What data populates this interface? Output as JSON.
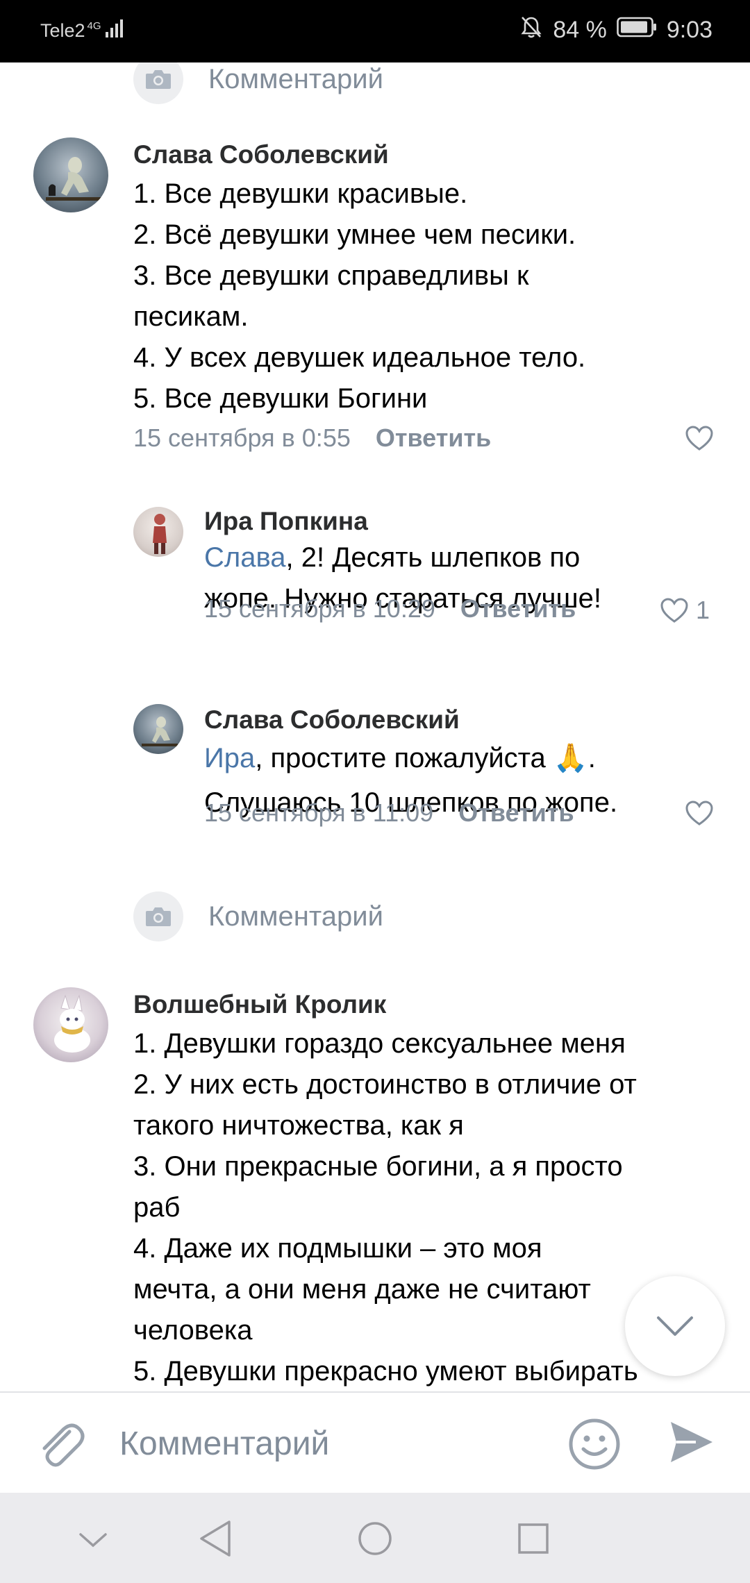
{
  "status_bar": {
    "carrier": "Tele2",
    "network": "4G",
    "battery": "84 %",
    "time": "9:03",
    "icons": [
      "signal-icon",
      "mute-bell-icon",
      "battery-icon"
    ]
  },
  "comments": [
    {
      "author": "Слава Соболевский",
      "lines": [
        "1. Все девушки красивые.",
        "2. Всё девушки умнее чем песики.",
        "3. Все девушки справедливы к",
        "песикам.",
        "4. У всех девушек идеальное тело.",
        "5. Все девушки Богини"
      ],
      "date": "15 сентября в 0:55",
      "reply_label": "Ответить",
      "likes": ""
    },
    {
      "author": "Ира Попкина",
      "mention": "Слава",
      "line1_rest": ", 2! Десять шлепков по",
      "line2": "жопе. Нужно стараться лучше!",
      "date": "15 сентября в 10:29",
      "reply_label": "Ответить",
      "likes": "1"
    },
    {
      "author": "Слава Соболевский",
      "mention": "Ира",
      "line1_rest": ", простите пожалуйста 🙏.",
      "line2": "Слушаюсь 10 шлепков по жопе.",
      "date": "15 сентября в 11:09",
      "reply_label": "Ответить",
      "likes": ""
    },
    {
      "author": "Волшебный Кролик",
      "lines": [
        "1. Девушки гораздо сексуальнее меня",
        "2. У них есть достоинство в отличие от",
        "такого ничтожества, как я",
        "3. Они прекрасные богини, а я просто",
        "раб",
        "4. Даже их подмышки – это моя",
        "мечта, а они меня даже не считают",
        "человека",
        "5. Девушки прекрасно умеют выбирать"
      ]
    }
  ],
  "comment_prompt": {
    "label": "Комментарий"
  },
  "input": {
    "placeholder": "Комментарий"
  },
  "colors": {
    "accent": "#4a76a8",
    "secondary_text": "#818c99",
    "status_bar_bg": "#000000",
    "nav_bar_bg": "#ebebee"
  }
}
